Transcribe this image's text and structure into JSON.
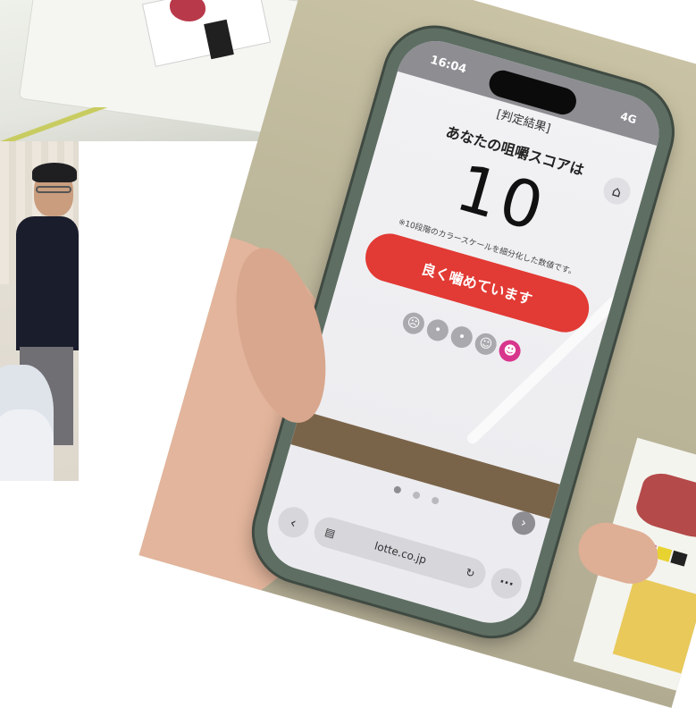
{
  "phone": {
    "status_time": "16:04",
    "network": "4G",
    "header_label": "[判定結果]",
    "score_title": "あなたの咀嚼スコアは",
    "score_value": "10",
    "score_note": "※10段階のカラースケールを細分化した数値です。",
    "result_text": "良く噛めています",
    "faces": [
      "sad-face-icon",
      "neutral-face-icon",
      "neutral-face-icon",
      "smile-face-icon",
      "happy-face-icon"
    ],
    "active_face_index": 4,
    "browser_url": "lotte.co.jp"
  },
  "colors": {
    "result_button": "#e23a34",
    "active_face": "#d8368c",
    "phone_case": "#5e6e63"
  }
}
